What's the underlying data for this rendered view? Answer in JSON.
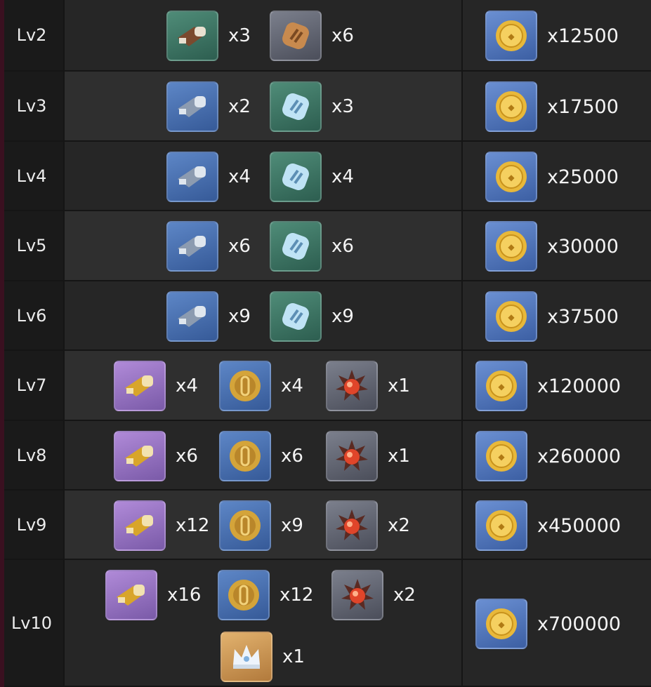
{
  "colors": {
    "coin": "#e8b83a",
    "label_bg": "#1a1a1a",
    "row_bg": "#262626",
    "row_alt_bg": "#2f2f2f"
  },
  "rows": [
    {
      "level": "Lv2",
      "materials": [
        {
          "icon": "brown-scroll-icon",
          "qty": "x3"
        },
        {
          "icon": "bronze-gem-icon",
          "qty": "x6"
        }
      ],
      "coins": "x12500"
    },
    {
      "level": "Lv3",
      "materials": [
        {
          "icon": "silver-scroll-icon",
          "qty": "x2"
        },
        {
          "icon": "crystal-gem-icon",
          "qty": "x3"
        }
      ],
      "coins": "x17500"
    },
    {
      "level": "Lv4",
      "materials": [
        {
          "icon": "silver-scroll-icon",
          "qty": "x4"
        },
        {
          "icon": "crystal-gem-icon",
          "qty": "x4"
        }
      ],
      "coins": "x25000"
    },
    {
      "level": "Lv5",
      "materials": [
        {
          "icon": "silver-scroll-icon",
          "qty": "x6"
        },
        {
          "icon": "crystal-gem-icon",
          "qty": "x6"
        }
      ],
      "coins": "x30000"
    },
    {
      "level": "Lv6",
      "materials": [
        {
          "icon": "silver-scroll-icon",
          "qty": "x9"
        },
        {
          "icon": "crystal-gem-icon",
          "qty": "x9"
        }
      ],
      "coins": "x37500"
    },
    {
      "level": "Lv7",
      "materials": [
        {
          "icon": "gold-scroll-icon",
          "qty": "x4"
        },
        {
          "icon": "gold-medallion-icon",
          "qty": "x4"
        },
        {
          "icon": "red-core-icon",
          "qty": "x1"
        }
      ],
      "coins": "x120000"
    },
    {
      "level": "Lv8",
      "materials": [
        {
          "icon": "gold-scroll-icon",
          "qty": "x6"
        },
        {
          "icon": "gold-medallion-icon",
          "qty": "x6"
        },
        {
          "icon": "red-core-icon",
          "qty": "x1"
        }
      ],
      "coins": "x260000"
    },
    {
      "level": "Lv9",
      "materials": [
        {
          "icon": "gold-scroll-icon",
          "qty": "x12"
        },
        {
          "icon": "gold-medallion-icon",
          "qty": "x9"
        },
        {
          "icon": "red-core-icon",
          "qty": "x2"
        }
      ],
      "coins": "x450000"
    },
    {
      "level": "Lv10",
      "materials": [
        {
          "icon": "gold-scroll-icon",
          "qty": "x16"
        },
        {
          "icon": "gold-medallion-icon",
          "qty": "x12"
        },
        {
          "icon": "red-core-icon",
          "qty": "x2"
        },
        {
          "icon": "crown-icon",
          "qty": "x1"
        }
      ],
      "coins": "x700000"
    }
  ]
}
